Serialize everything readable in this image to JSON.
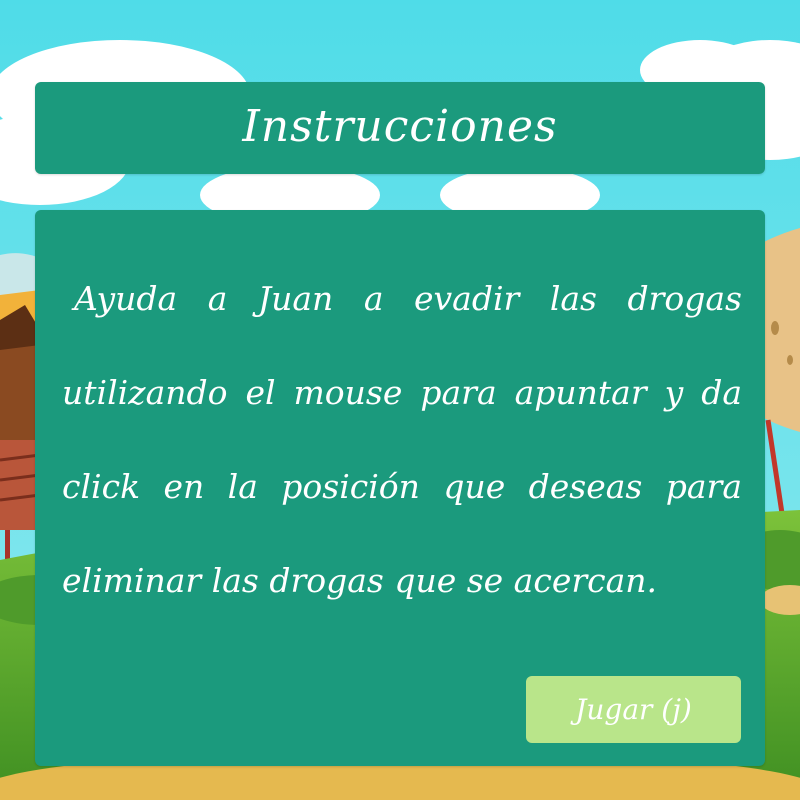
{
  "instructions_screen": {
    "title": "Instrucciones",
    "body": "Ayuda a Juan a evadir las drogas utilizando el mouse para apuntar y da click en la posición que deseas para eliminar las drogas que se acercan.",
    "play_button_label": "Jugar (j)"
  },
  "colors": {
    "panel": "#1b9a7d",
    "play_button": "#b9e58a",
    "sky": "#4fdce8",
    "grass": "#5aa82e"
  }
}
